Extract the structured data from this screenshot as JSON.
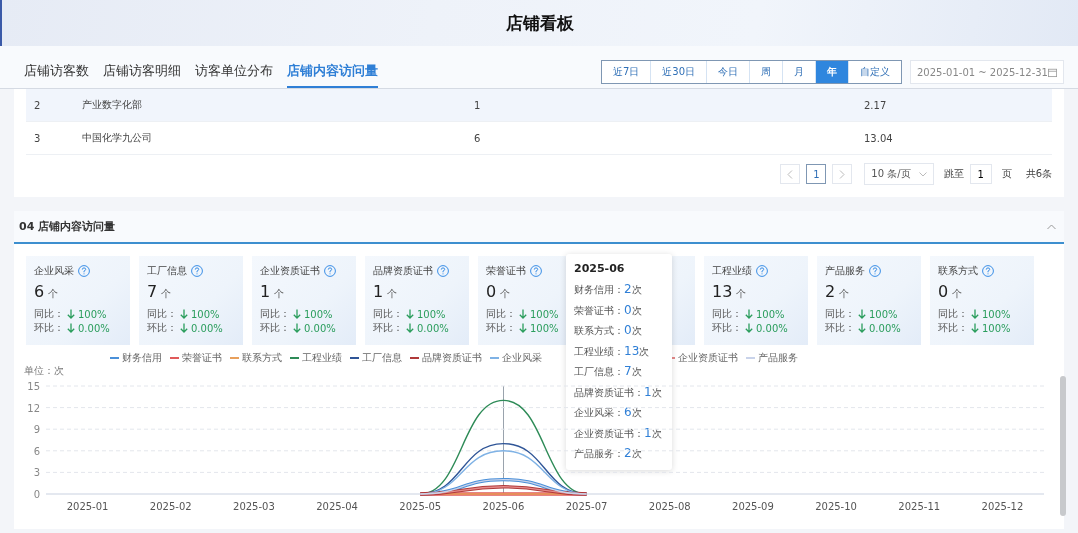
{
  "header": {
    "title": "店铺看板"
  },
  "tabs": [
    {
      "label": "店铺访客数",
      "selected": false
    },
    {
      "label": "店铺访客明细",
      "selected": false
    },
    {
      "label": "访客单位分布",
      "selected": false
    },
    {
      "label": "店铺内容访问量",
      "selected": true
    }
  ],
  "range_buttons": [
    {
      "label": "近7日",
      "selected": false
    },
    {
      "label": "近30日",
      "selected": false
    },
    {
      "label": "今日",
      "selected": false
    },
    {
      "label": "周",
      "selected": false
    },
    {
      "label": "月",
      "selected": false
    },
    {
      "label": "年",
      "selected": true
    },
    {
      "label": "自定义",
      "selected": false
    }
  ],
  "date_range": {
    "value": "2025-01-01 ~ 2025-12-31"
  },
  "table": {
    "rows": [
      {
        "cells": [
          "2",
          "产业数字化部",
          "1",
          "2.17"
        ],
        "hovered": true
      },
      {
        "cells": [
          "3",
          "中国化学九公司",
          "6",
          "13.04"
        ],
        "hovered": false
      }
    ]
  },
  "pagination": {
    "pages": [
      {
        "label": "1",
        "selected": true
      }
    ],
    "page_size": "10 条/页",
    "jump_label": "跳至",
    "jump_value": "1",
    "page_unit": "页",
    "total": "共6条"
  },
  "section": {
    "title": "04 店铺内容访问量",
    "expanded": true
  },
  "cards": [
    {
      "title": "企业风采",
      "value": "6",
      "unit": "个",
      "yoy_label": "同比：",
      "yoy": "100%",
      "yoy_down": true,
      "mom_label": "环比：",
      "mom": "0.00%",
      "mom_down": true
    },
    {
      "title": "工厂信息",
      "value": "7",
      "unit": "个",
      "yoy_label": "同比：",
      "yoy": "100%",
      "yoy_down": true,
      "mom_label": "环比：",
      "mom": "0.00%",
      "mom_down": true
    },
    {
      "title": "企业资质证书",
      "value": "1",
      "unit": "个",
      "yoy_label": "同比：",
      "yoy": "100%",
      "yoy_down": true,
      "mom_label": "环比：",
      "mom": "0.00%",
      "mom_down": true
    },
    {
      "title": "品牌资质证书",
      "value": "1",
      "unit": "个",
      "yoy_label": "同比：",
      "yoy": "100%",
      "yoy_down": true,
      "mom_label": "环比：",
      "mom": "0.00%",
      "mom_down": true
    },
    {
      "title": "荣誉证书",
      "value": "0",
      "unit": "个",
      "yoy_label": "同比：",
      "yoy": "100%",
      "yoy_down": true,
      "mom_label": "环比：",
      "mom": "100%",
      "mom_down": true
    },
    {
      "title": "工程业绩",
      "value": "13",
      "unit": "个",
      "yoy_label": "同比：",
      "yoy": "100%",
      "yoy_down": true,
      "mom_label": "环比：",
      "mom": "0.00%",
      "mom_down": true
    },
    {
      "title": "产品服务",
      "value": "2",
      "unit": "个",
      "yoy_label": "同比：",
      "yoy": "100%",
      "yoy_down": true,
      "mom_label": "环比：",
      "mom": "0.00%",
      "mom_down": true
    },
    {
      "title": "联系方式",
      "value": "0",
      "unit": "个",
      "yoy_label": "同比：",
      "yoy": "100%",
      "yoy_down": true,
      "mom_label": "环比：",
      "mom": "100%",
      "mom_down": true
    }
  ],
  "chart": {
    "chart_data": {
      "type": "line",
      "ylabel": "单位：次",
      "categories": [
        "2025-01",
        "2025-02",
        "2025-03",
        "2025-04",
        "2025-05",
        "2025-06",
        "2025-07",
        "2025-08",
        "2025-09",
        "2025-10",
        "2025-11",
        "2025-12"
      ],
      "ylim": [
        0,
        15
      ],
      "yticks": [
        0,
        3,
        6,
        9,
        12,
        15
      ],
      "grid": true,
      "series": [
        {
          "name": "财务信用",
          "color": "#4a90d9",
          "values": [
            null,
            null,
            null,
            null,
            0,
            2,
            0,
            null,
            null,
            null,
            null,
            null
          ]
        },
        {
          "name": "荣誉证书",
          "color": "#e05a5a",
          "values": [
            null,
            null,
            null,
            null,
            0,
            0,
            0,
            null,
            null,
            null,
            null,
            null
          ]
        },
        {
          "name": "联系方式",
          "color": "#e8a05c",
          "values": [
            null,
            null,
            null,
            null,
            0,
            0,
            0,
            null,
            null,
            null,
            null,
            null
          ]
        },
        {
          "name": "工程业绩",
          "color": "#2e8b57",
          "values": [
            null,
            null,
            null,
            null,
            0,
            13,
            0,
            null,
            null,
            null,
            null,
            null
          ]
        },
        {
          "name": "工厂信息",
          "color": "#2f5597",
          "values": [
            null,
            null,
            null,
            null,
            0,
            7,
            0,
            null,
            null,
            null,
            null,
            null
          ]
        },
        {
          "name": "品牌资质证书",
          "color": "#b03a3a",
          "values": [
            null,
            null,
            null,
            null,
            0,
            1,
            0,
            null,
            null,
            null,
            null,
            null
          ]
        },
        {
          "name": "企业风采",
          "color": "#7fb2e5",
          "values": [
            null,
            null,
            null,
            null,
            0,
            6,
            0,
            null,
            null,
            null,
            null,
            null
          ]
        },
        {
          "name": "企业资质证书",
          "color": "#e58a8a",
          "values": [
            null,
            null,
            null,
            null,
            0,
            1,
            0,
            null,
            null,
            null,
            null,
            null
          ]
        },
        {
          "name": "产品服务",
          "color": "#c9d3ea",
          "values": [
            null,
            null,
            null,
            null,
            0,
            2,
            0,
            null,
            null,
            null,
            null,
            null
          ]
        }
      ]
    }
  },
  "tooltip": {
    "title": "2025-06",
    "items": [
      {
        "label": "财务信用：",
        "value": "2",
        "unit": "次"
      },
      {
        "label": "荣誉证书：",
        "value": "0",
        "unit": "次"
      },
      {
        "label": "联系方式：",
        "value": "0",
        "unit": "次"
      },
      {
        "label": "工程业绩：",
        "value": "13",
        "unit": "次"
      },
      {
        "label": "工厂信息：",
        "value": "7",
        "unit": "次"
      },
      {
        "label": "品牌资质证书：",
        "value": "1",
        "unit": "次"
      },
      {
        "label": "企业风采：",
        "value": "6",
        "unit": "次"
      },
      {
        "label": "企业资质证书：",
        "value": "1",
        "unit": "次"
      },
      {
        "label": "产品服务：",
        "value": "2",
        "unit": "次"
      }
    ]
  }
}
